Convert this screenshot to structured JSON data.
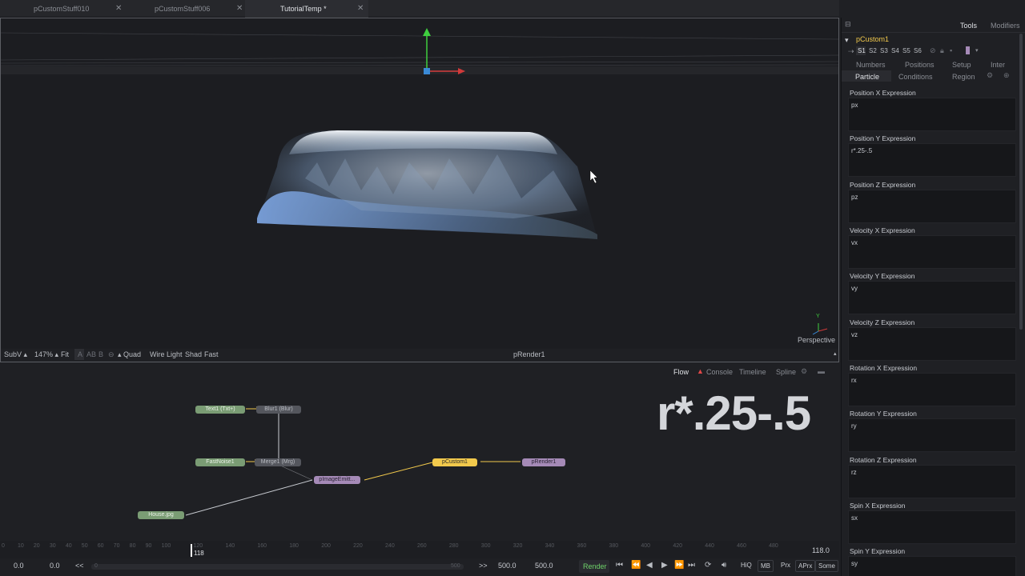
{
  "tabs": [
    {
      "label": "pCustomStuff010",
      "active": false
    },
    {
      "label": "pCustomStuff006",
      "active": false
    },
    {
      "label": "TutorialTemp *",
      "active": true
    }
  ],
  "viewer": {
    "camera_label": "Perspective",
    "axis_label": "Y",
    "toolbar": {
      "subv": "SubV",
      "zoom": "147%",
      "fit": "Fit",
      "a": "A",
      "ab": "AB",
      "b": "B",
      "quad": "Quad",
      "wire": "Wire",
      "light": "Light",
      "shad": "Shad",
      "fast": "Fast",
      "node_name": "pRender1"
    }
  },
  "right_panel": {
    "tools_tab": "Tools",
    "modifiers_tab": "Modifiers",
    "node_title": "pCustom1",
    "sets": [
      "S1",
      "S2",
      "S3",
      "S4",
      "S5",
      "S6"
    ],
    "row1_tabs": [
      "Numbers",
      "Positions",
      "Setup",
      "Inter"
    ],
    "row2_tabs": [
      "Particle",
      "Conditions",
      "Region"
    ],
    "expressions": [
      {
        "label": "Position X Expression",
        "value": "px"
      },
      {
        "label": "Position Y Expression",
        "value": "r*.25-.5"
      },
      {
        "label": "Position Z Expression",
        "value": "pz"
      },
      {
        "label": "Velocity X Expression",
        "value": "vx"
      },
      {
        "label": "Velocity Y Expression",
        "value": "vy"
      },
      {
        "label": "Velocity Z Expression",
        "value": "vz"
      },
      {
        "label": "Rotation X Expression",
        "value": "rx"
      },
      {
        "label": "Rotation Y Expression",
        "value": "ry"
      },
      {
        "label": "Rotation Z Expression",
        "value": "rz"
      },
      {
        "label": "Spin X Expression",
        "value": "sx"
      },
      {
        "label": "Spin Y Expression",
        "value": "sy"
      }
    ]
  },
  "flow_bar": {
    "tabs": [
      "Flow",
      "Console",
      "Timeline",
      "Spline"
    ]
  },
  "flow": {
    "nodes": {
      "text1": "Text1 (Txt+)",
      "blur1": "Blur1 (Blur)",
      "fastnoise1": "FastNoise1",
      "merge1": "Merge1 (Mrg)",
      "pimageemitter": "pImageEmitt...",
      "pcustom1": "pCustom1",
      "prender1": "pRender1",
      "house": "House.jpg"
    },
    "overlay_text": "r*.25-.5"
  },
  "timeline": {
    "ruler_ticks": [
      "0",
      "10",
      "20",
      "30",
      "40",
      "50",
      "60",
      "70",
      "80",
      "90",
      "100",
      "120",
      "140",
      "160",
      "180",
      "200",
      "220",
      "240",
      "260",
      "280",
      "300",
      "320",
      "340",
      "360",
      "380",
      "400",
      "420",
      "440",
      "460",
      "480"
    ],
    "current_frame": "118",
    "end_readout": "118.0",
    "global_start": "0.0",
    "render_start": "0.0",
    "range_left": "<<",
    "range_right": ">>",
    "range_min": "0",
    "range_max": "500",
    "render_end": "500.0",
    "global_end": "500.0",
    "render_button": "Render",
    "hiq": "HiQ",
    "mb": "MB",
    "prx": "Prx",
    "aprx": "APrx",
    "some": "Some"
  },
  "colors": {
    "accent_yellow": "#f2c94c",
    "render_green": "#6fd46a",
    "flow_active": "#e0e2e6",
    "warning_red": "#e04848"
  }
}
